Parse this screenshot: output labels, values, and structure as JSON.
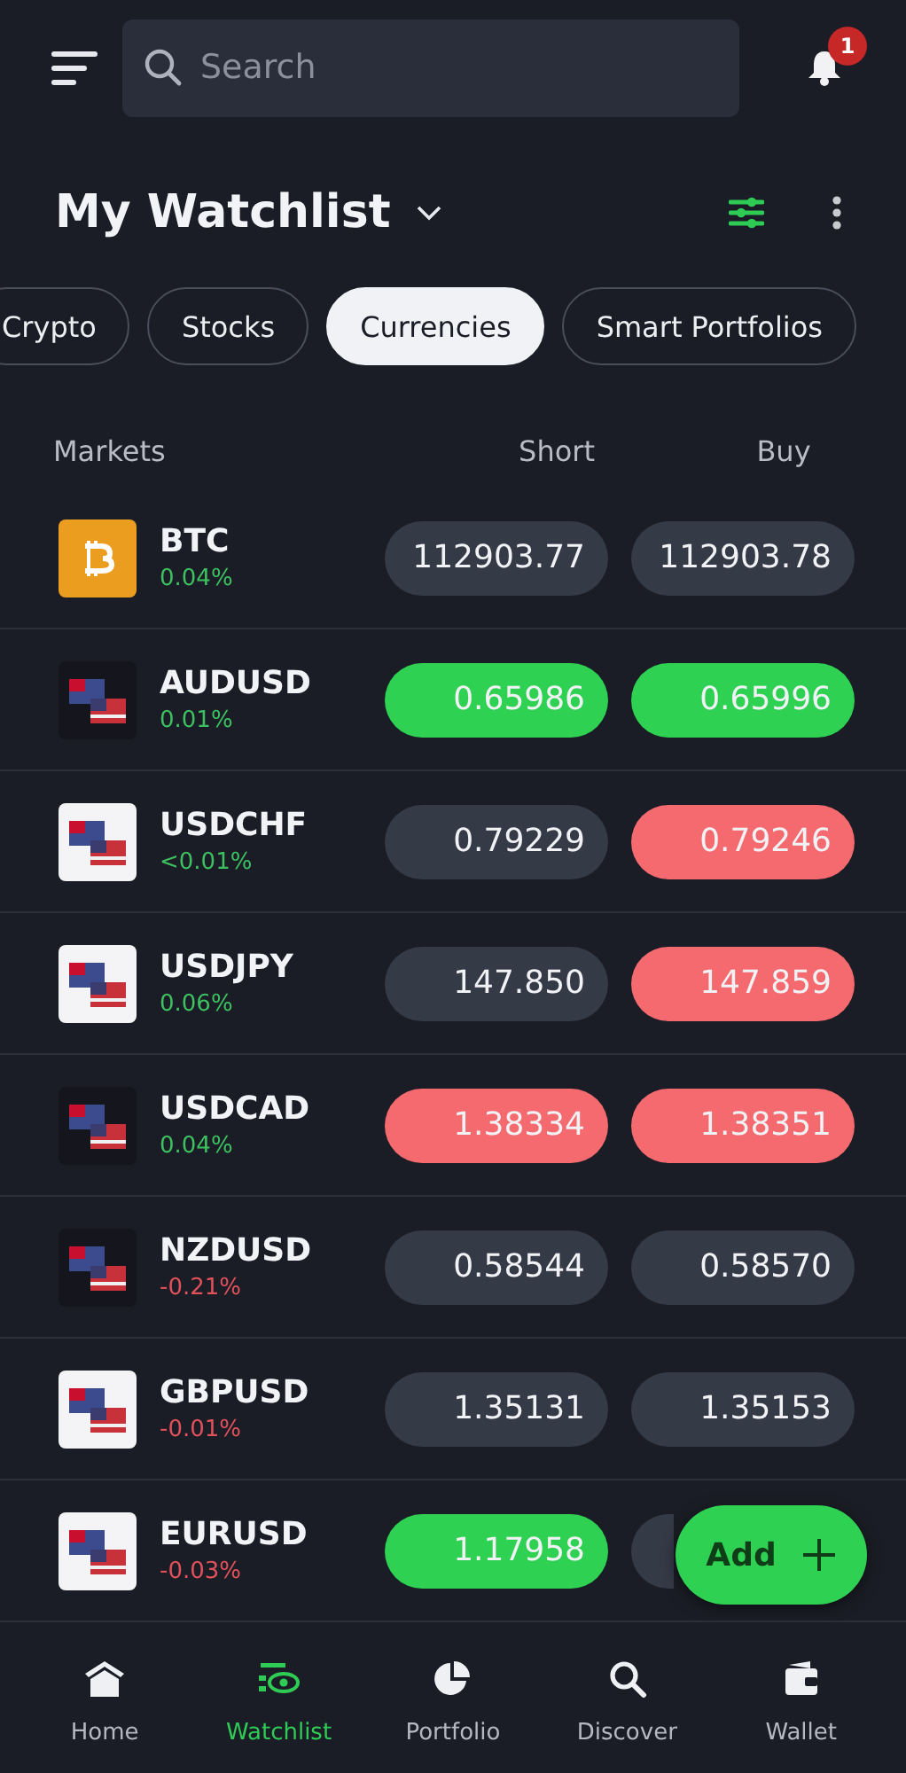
{
  "header": {
    "search": {
      "placeholder": "Search"
    },
    "notifications": {
      "count": "1"
    }
  },
  "title": "My Watchlist",
  "tabs": [
    {
      "label": "Crypto",
      "selected": false
    },
    {
      "label": "Stocks",
      "selected": false
    },
    {
      "label": "Currencies",
      "selected": true
    },
    {
      "label": "Smart Portfolios",
      "selected": false
    }
  ],
  "table": {
    "columns": [
      "Markets",
      "Short",
      "Buy"
    ],
    "rows": [
      {
        "symbol": "BTC",
        "change": "0.04%",
        "color": "#3cc060",
        "icon": {
          "kind": "coin",
          "color": "#eb9d1f"
        },
        "short": {
          "price": "112903.77",
          "color": "#353a47"
        },
        "buy": {
          "price": "112903.78",
          "color": "#353a47"
        }
      },
      {
        "symbol": "AUDUSD",
        "change": "0.01%",
        "color": "#3cc060",
        "icon": {
          "kind": "flags",
          "color": "#15161d"
        },
        "short": {
          "price": "0.65986",
          "color": "#2fd152"
        },
        "buy": {
          "price": "0.65996",
          "color": "#2fd152"
        }
      },
      {
        "symbol": "USDCHF",
        "change": "<0.01%",
        "color": "#3cc060",
        "icon": {
          "kind": "flags",
          "color": "#f4f4f6"
        },
        "short": {
          "price": "0.79229",
          "color": "#353a47"
        },
        "buy": {
          "price": "0.79246",
          "color": "#f46a6e"
        }
      },
      {
        "symbol": "USDJPY",
        "change": "0.06%",
        "color": "#3cc060",
        "icon": {
          "kind": "flags",
          "color": "#f4f4f6"
        },
        "short": {
          "price": "147.850",
          "color": "#353a47"
        },
        "buy": {
          "price": "147.859",
          "color": "#f46a6e"
        }
      },
      {
        "symbol": "USDCAD",
        "change": "0.04%",
        "color": "#3cc060",
        "icon": {
          "kind": "flags",
          "color": "#15161d"
        },
        "short": {
          "price": "1.38334",
          "color": "#f46a6e"
        },
        "buy": {
          "price": "1.38351",
          "color": "#f46a6e"
        }
      },
      {
        "symbol": "NZDUSD",
        "change": "-0.21%",
        "color": "#e0515a",
        "icon": {
          "kind": "flags",
          "color": "#15161d"
        },
        "short": {
          "price": "0.58544",
          "color": "#353a47"
        },
        "buy": {
          "price": "0.58570",
          "color": "#353a47"
        }
      },
      {
        "symbol": "GBPUSD",
        "change": "-0.01%",
        "color": "#e0515a",
        "icon": {
          "kind": "flags",
          "color": "#f4f4f6"
        },
        "short": {
          "price": "1.35131",
          "color": "#353a47"
        },
        "buy": {
          "price": "1.35153",
          "color": "#353a47"
        }
      },
      {
        "symbol": "EURUSD",
        "change": "-0.03%",
        "color": "#e0515a",
        "icon": {
          "kind": "flags",
          "color": "#f4f4f6"
        },
        "short": {
          "price": "1.17958",
          "color": "#2fd152"
        },
        "buy": {
          "color": "#353a47"
        }
      }
    ]
  },
  "fab": {
    "label": "Add"
  },
  "nav": [
    {
      "label": "Home",
      "kind": "home",
      "selected": false
    },
    {
      "label": "Watchlist",
      "kind": "watchlist",
      "selected": true
    },
    {
      "label": "Portfolio",
      "kind": "portfolio",
      "selected": false
    },
    {
      "label": "Discover",
      "kind": "discover",
      "selected": false
    },
    {
      "label": "Wallet",
      "kind": "wallet",
      "selected": false
    }
  ]
}
